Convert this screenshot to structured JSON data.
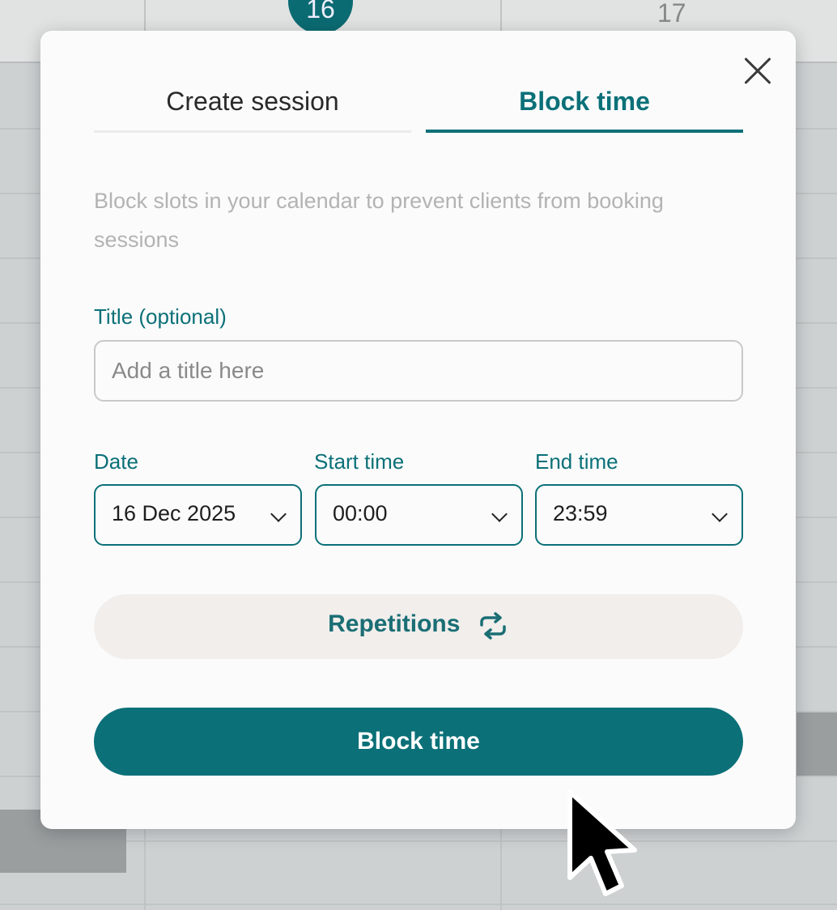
{
  "calendar": {
    "day_current": "16",
    "day_next": "17"
  },
  "modal": {
    "tabs": [
      {
        "label": "Create session"
      },
      {
        "label": "Block time"
      }
    ],
    "description": "Block slots in your calendar to prevent clients from booking sessions",
    "title_field": {
      "label": "Title (optional)",
      "placeholder": "Add a title here",
      "value": ""
    },
    "date_field": {
      "label": "Date",
      "value": "16 Dec 2025"
    },
    "start_field": {
      "label": "Start time",
      "value": "00:00"
    },
    "end_field": {
      "label": "End time",
      "value": "23:59"
    },
    "repetitions_label": "Repetitions",
    "submit_label": "Block time"
  },
  "icons": {
    "close": "close-icon",
    "chevron": "chevron-down-icon",
    "repeat": "repeat-icon",
    "cursor": "mouse-pointer-icon"
  },
  "colors": {
    "accent": "#0b7078",
    "repetitions_bg": "#f1eeec",
    "description_text": "#b3b3b3"
  }
}
